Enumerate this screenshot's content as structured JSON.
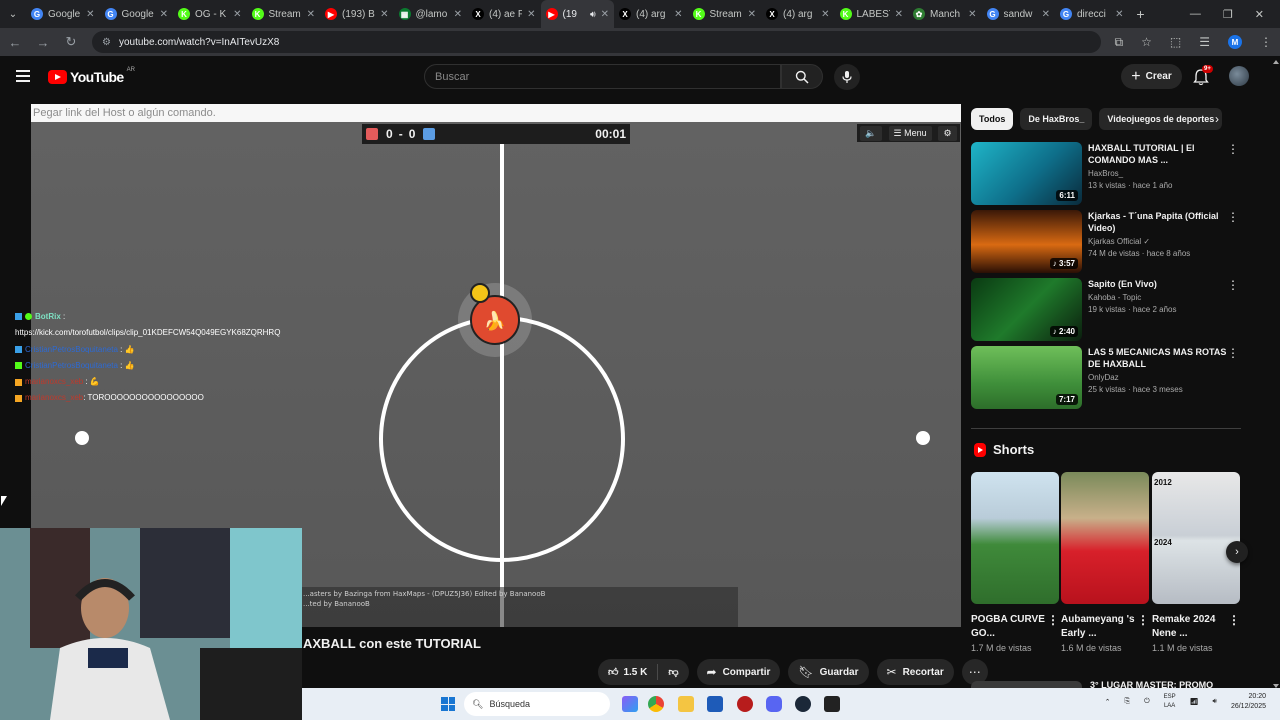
{
  "browser": {
    "tabs": [
      {
        "label": "Google",
        "color": "#4285f4",
        "glyph": "G"
      },
      {
        "label": "Google",
        "color": "#4285f4",
        "glyph": "G"
      },
      {
        "label": "OG - K",
        "color": "#53fc18",
        "glyph": "K"
      },
      {
        "label": "Stream",
        "color": "#53fc18",
        "glyph": "K"
      },
      {
        "label": "(193) B",
        "color": "#ff0000",
        "glyph": "▶"
      },
      {
        "label": "@lamo",
        "color": "#0a7a2f",
        "glyph": "▦"
      },
      {
        "label": "(4) ae F",
        "color": "#000000",
        "glyph": "X"
      },
      {
        "label": "(19",
        "color": "#ff0000",
        "glyph": "▶",
        "active": true
      },
      {
        "label": "(4) arg",
        "color": "#000000",
        "glyph": "X"
      },
      {
        "label": "Stream",
        "color": "#53fc18",
        "glyph": "K"
      },
      {
        "label": "(4) arg",
        "color": "#000000",
        "glyph": "X"
      },
      {
        "label": "LABEST",
        "color": "#53fc18",
        "glyph": "K"
      },
      {
        "label": "Manch",
        "color": "#2e7d32",
        "glyph": "✿"
      },
      {
        "label": "sandw",
        "color": "#4285f4",
        "glyph": "G"
      },
      {
        "label": "direcci",
        "color": "#4285f4",
        "glyph": "G"
      }
    ],
    "url": "youtube.com/watch?v=InAITevUzX8",
    "profile_initial": "M"
  },
  "youtube": {
    "logo_text": "YouTube",
    "country": "AR",
    "search_placeholder": "Buscar",
    "create_label": "Crear",
    "notif_badge": "9+"
  },
  "player": {
    "command_placeholder": "Pegar link del Host o algún comando.",
    "score_red": "0",
    "score_sep": "-",
    "score_blue": "0",
    "time": "00:01",
    "menu_label": "Menu",
    "colors": {
      "red_team": "#e35b5b",
      "blue_team": "#5b9ce3",
      "ball": "#f5c518"
    },
    "chat": [
      {
        "user": "BotRix",
        "text": "",
        "color": "#7ee1c3"
      },
      {
        "user": "",
        "text": "https://kick.com/torofutbol/clips/clip_01KDEFCW54Q049EGYK68ZQRHRQ",
        "color": "#ffffff"
      },
      {
        "user": "CristianPetrosBoquitaneta",
        "text": ":",
        "color": "#2d6ad4"
      },
      {
        "user": "CristianPetrosBoquitaneta",
        "text": ":",
        "color": "#2d6ad4"
      },
      {
        "user": "marianoxcs_xeb",
        "text": ":",
        "color": "#c0392b"
      },
      {
        "user": "marianoxcs_xeb",
        "text": ": TOROOOOOOOOOOOOOOOO",
        "color": "#c0392b"
      }
    ],
    "map_credit_1": "...asters by Bazinga from HaxMaps - (DPUZ5J36) Edited by BananooB",
    "map_credit_2": "...ted by BananooB"
  },
  "video": {
    "title": "AXBALL con este TUTORIAL",
    "likes": "1.5 K",
    "share": "Compartir",
    "save": "Guardar",
    "clip": "Recortar"
  },
  "sidebar": {
    "chips": [
      "Todos",
      "De HaxBros_",
      "Videojuegos de deportes"
    ],
    "recommendations": [
      {
        "title": "HAXBALL TUTORIAL | El COMANDO MAS ...",
        "channel": "HaxBros_",
        "meta": "13 k vistas · hace 1 año",
        "duration": "6:11",
        "thumb_bg": "linear-gradient(135deg,#1fb5c8,#0e6f8a 55%,#0a2b3c)"
      },
      {
        "title": "Kjarkas - T´una Papita (Official Video)",
        "channel": "Kjarkas Official ✓",
        "meta": "74 M de vistas · hace 8 años",
        "duration": "♪ 3:57",
        "thumb_bg": "linear-gradient(180deg,#3a1808,#d96a12 55%,#2a0f05)"
      },
      {
        "title": "Sapito (En Vivo)",
        "channel": "Kahoba - Topic",
        "meta": "19 k vistas · hace 2 años",
        "duration": "♪ 2:40",
        "thumb_bg": "linear-gradient(135deg,#0a3a12,#1f7a2b 50%,#0b1f0e)"
      },
      {
        "title": "LAS 5 MECANICAS MAS ROTAS DE HAXBALL",
        "channel": "OnlyDaz",
        "meta": "25 k vistas · hace 3 meses",
        "duration": "7:17",
        "thumb_bg": "linear-gradient(180deg,#6fbf5a,#3f8f3a 60%,#2d6e2a)"
      }
    ],
    "shorts_title": "Shorts",
    "shorts": [
      {
        "title": "POGBA CURVE GO...",
        "views": "1.7 M de vistas",
        "bg": "linear-gradient(180deg,#cfe3ef 0%,#b9ccd9 35%,#3f8a3a 55%,#2f6e2c 100%)"
      },
      {
        "title": "Aubameyang 's Early ...",
        "views": "1.6 M de vistas",
        "bg": "linear-gradient(180deg,#7a8a5a 0%,#c8b08a 35%,#d8202a 60%,#b8121d 100%)"
      },
      {
        "title": "Remake 2024 Nene ...",
        "views": "1.1 M de vistas",
        "bg": "linear-gradient(180deg,#e8e8e8 0%,#c9cfd6 48%,#dde3e6 52%,#b6bcc4 100%)"
      }
    ],
    "shorts_year_a": "2012",
    "shorts_year_b": "2024",
    "next_title": "3° LUGAR MASTER: PROMO"
  },
  "taskbar": {
    "search_label": "Búsqueda",
    "lang_top": "ESP",
    "lang_bottom": "LAA",
    "time": "20:20",
    "date": "26/12/2025"
  }
}
